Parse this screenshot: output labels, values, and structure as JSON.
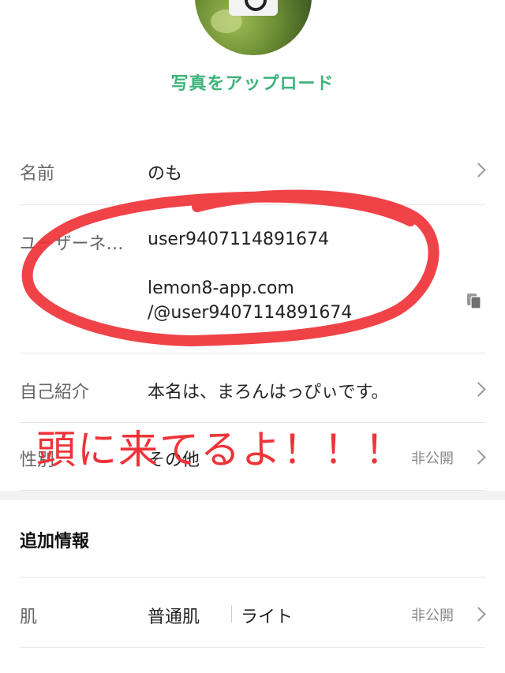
{
  "profile": {
    "upload_label": "写真をアップロード"
  },
  "fields": {
    "name": {
      "label": "名前",
      "value": "のも"
    },
    "username": {
      "label": "ユーザーネ…",
      "value": "user9407114891674",
      "link_line1": "lemon8-app.com",
      "link_line2": "/@user9407114891674"
    },
    "bio": {
      "label": "自己紹介",
      "value": "本名は、まろんはっぴぃです。"
    },
    "gender": {
      "label": "性別",
      "value": "その他",
      "visibility": "非公開"
    }
  },
  "additional": {
    "title": "追加情報",
    "skin": {
      "label": "肌",
      "value_a": "普通肌",
      "value_b": "ライト",
      "visibility": "非公開"
    }
  },
  "annotation": {
    "text": "頭に来てるよ！！！",
    "color": "#ef3338"
  },
  "colors": {
    "accent": "#3eb37c",
    "divider": "#e6e6e6",
    "muted": "#8a8a8a"
  }
}
